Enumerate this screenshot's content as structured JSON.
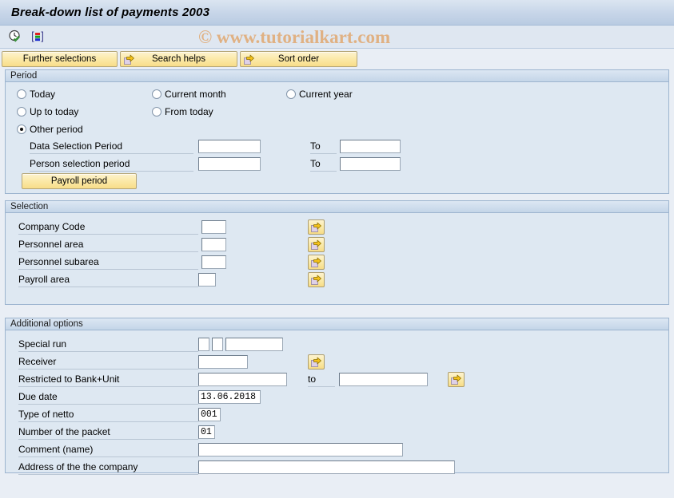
{
  "window": {
    "title": "Break-down list of payments 2003"
  },
  "watermark": "© www.tutorialkart.com",
  "toolbar": {
    "icons": [
      {
        "name": "clock-check-icon",
        "title": "Execute"
      },
      {
        "name": "variant-bars-icon",
        "title": "Get variant"
      }
    ]
  },
  "buttons": {
    "further_selections": "Further selections",
    "search_helps": "Search helps",
    "sort_order": "Sort order"
  },
  "period": {
    "header": "Period",
    "radios": [
      {
        "label": "Today",
        "selected": false
      },
      {
        "label": "Current month",
        "selected": false
      },
      {
        "label": "Current year",
        "selected": false
      },
      {
        "label": "Up to today",
        "selected": false
      },
      {
        "label": "From today",
        "selected": false
      },
      {
        "label": "Other period",
        "selected": true
      }
    ],
    "rows": [
      {
        "label": "Data Selection Period",
        "value": "",
        "to_label": "To",
        "to_value": ""
      },
      {
        "label": "Person selection period",
        "value": "",
        "to_label": "To",
        "to_value": ""
      }
    ],
    "payroll_period_button": "Payroll period"
  },
  "selection": {
    "header": "Selection",
    "rows": [
      {
        "label": "Company Code",
        "value": ""
      },
      {
        "label": "Personnel area",
        "value": ""
      },
      {
        "label": "Personnel subarea",
        "value": ""
      },
      {
        "label": "Payroll area",
        "value": ""
      }
    ]
  },
  "additional": {
    "header": "Additional options",
    "special_run": {
      "label": "Special run",
      "value_a": "",
      "value_b": "",
      "value_c": ""
    },
    "receiver": {
      "label": "Receiver",
      "value": ""
    },
    "bank_unit": {
      "label": "Restricted to Bank+Unit",
      "value": "",
      "to_label": "to",
      "to_value": ""
    },
    "due_date": {
      "label": "Due date",
      "value": "13.06.2018"
    },
    "type_of_netto": {
      "label": "Type of netto",
      "value": "001"
    },
    "number_of_packet": {
      "label": "Number of the packet",
      "value": "01"
    },
    "comment": {
      "label": "Comment (name)",
      "value": ""
    },
    "address": {
      "label": "Address of the the company",
      "value": ""
    }
  },
  "colors": {
    "title_bar": "#c6d5e8",
    "panel_bg": "#dee8f2",
    "button_yellow": "#fae9a6",
    "watermark": "#e0b183"
  }
}
